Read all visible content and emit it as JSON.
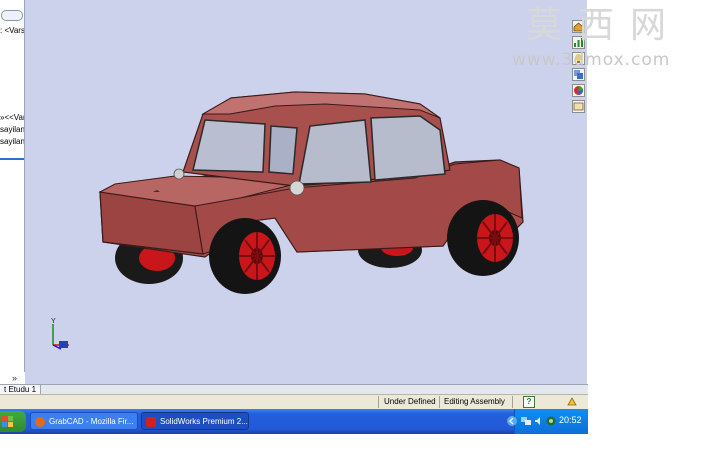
{
  "left_panel": {
    "tree_items": [
      ": <Vars-",
      "»<<Var",
      "sayilan",
      "sayilan"
    ],
    "scroll_arrow": "»"
  },
  "viewport": {
    "background": "#cdd2ec",
    "axis": {
      "y_label": "Y"
    }
  },
  "watermark": {
    "text_cn": "莫西网",
    "url": "www.3dmox.com"
  },
  "tabs": [
    {
      "label": "t Etudu 1"
    }
  ],
  "status_bar": {
    "state": "Under Defined",
    "mode": "Editing Assembly",
    "help": "?"
  },
  "taskbar": {
    "buttons": [
      {
        "label": "GrabCAD - Mozilla Fir..."
      },
      {
        "label": "SolidWorks Premium 2..."
      }
    ],
    "clock": "20:52"
  },
  "colors": {
    "car_body": "#a8504e",
    "wheel_rim": "#c8161a",
    "taskbar": "#245edb"
  }
}
